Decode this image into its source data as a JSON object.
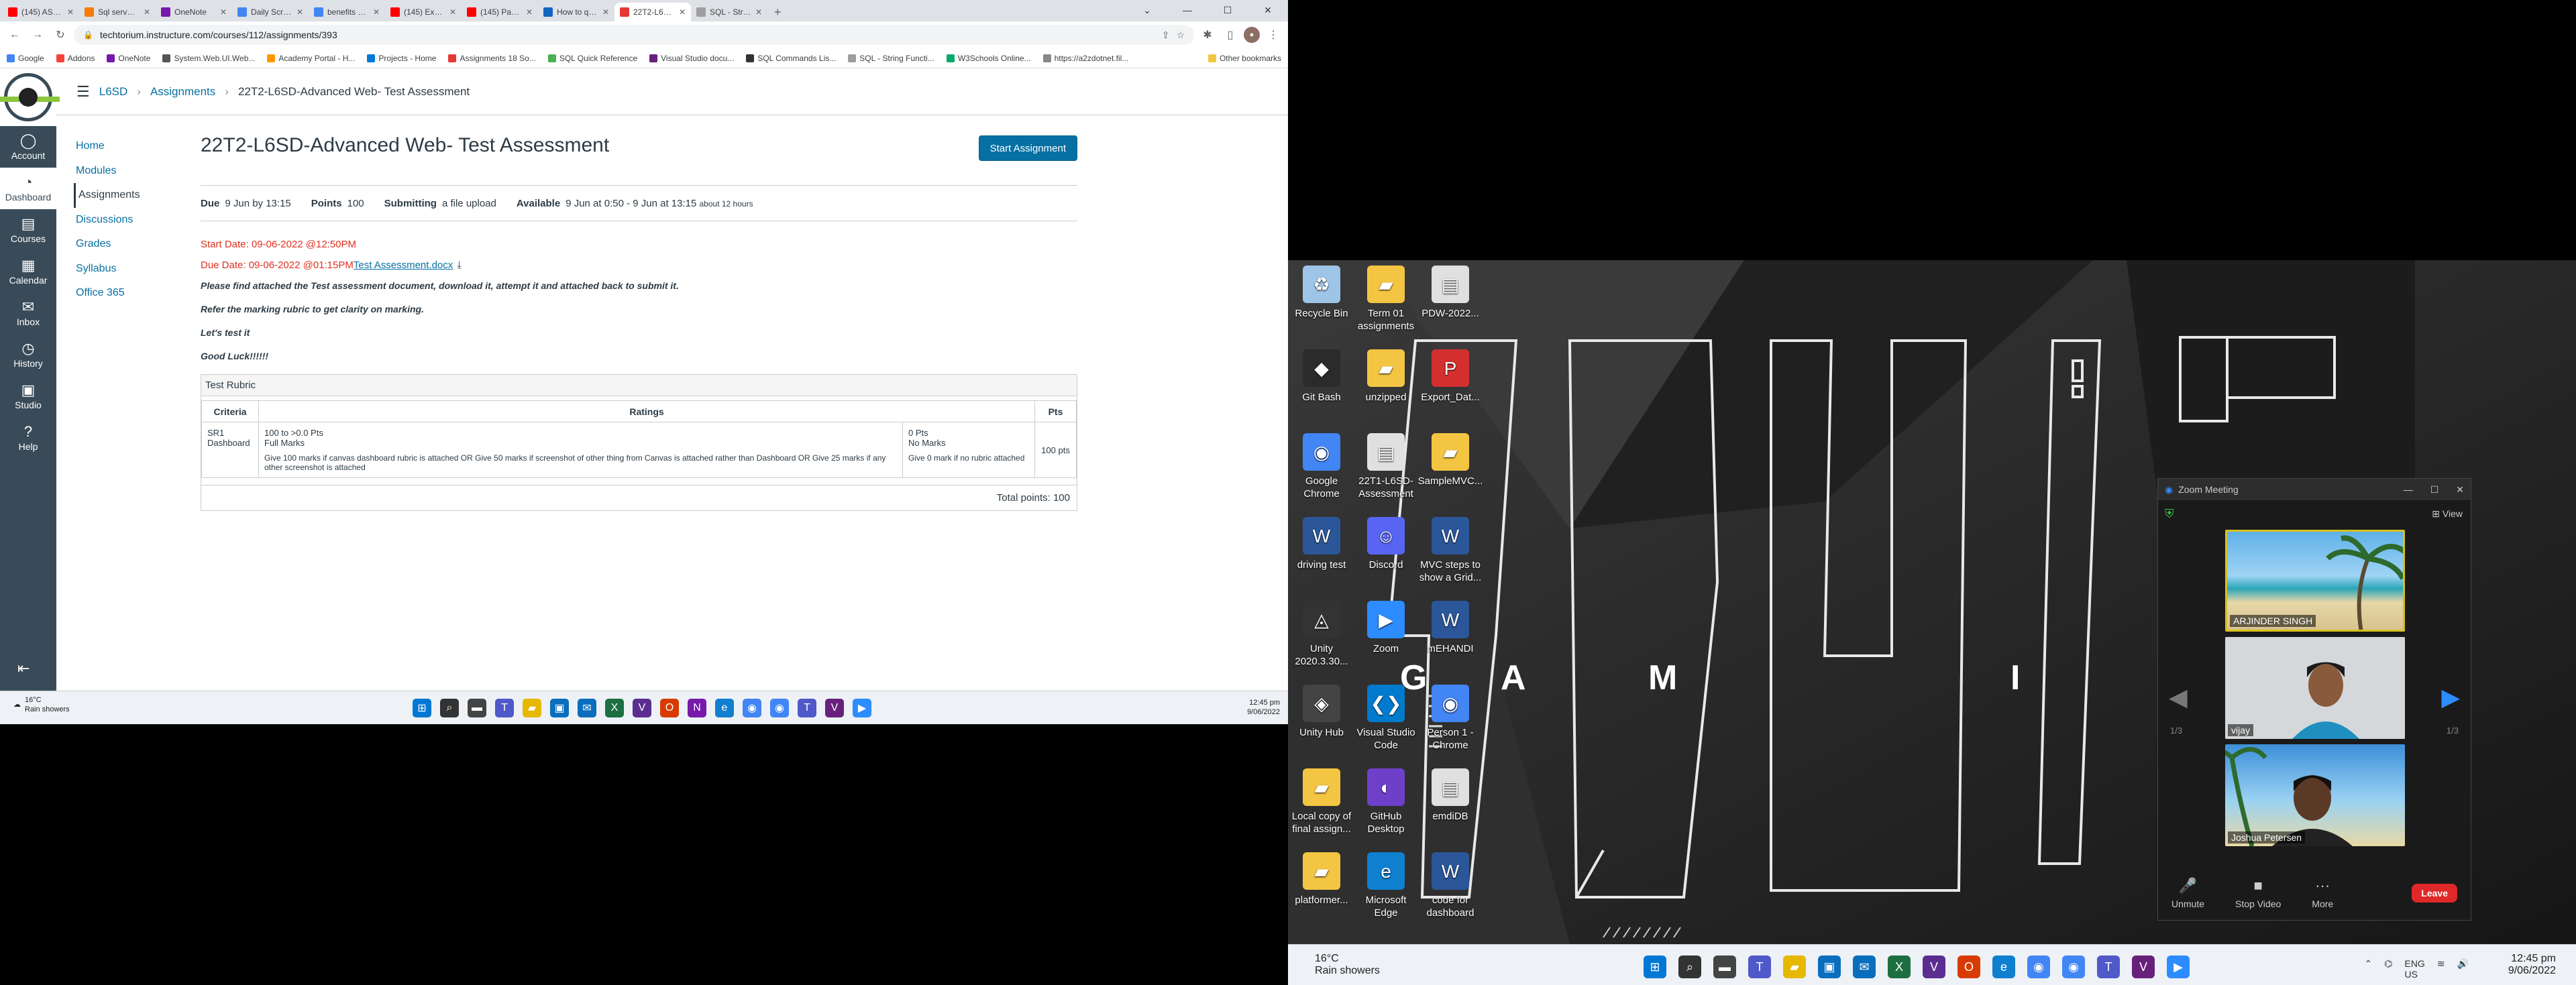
{
  "browser": {
    "tabs": [
      {
        "label": "(145) ASP.NET Co...",
        "color": "#ff0000"
      },
      {
        "label": "Sql server...net an...",
        "color": "#f57c00"
      },
      {
        "label": "OneNote",
        "color": "#7719aa"
      },
      {
        "label": "Daily Scrum Meeti...",
        "color": "#4285f4"
      },
      {
        "label": "benefits of reposit...",
        "color": "#4285f4"
      },
      {
        "label": "(145) Execute Auto...",
        "color": "#ff0000"
      },
      {
        "label": "(145) Part 2 - Crea...",
        "color": "#ff0000"
      },
      {
        "label": "How to query mul...",
        "color": "#1565c0"
      },
      {
        "label": "22T2-L6SD-Advan...",
        "color": "#e53935"
      },
      {
        "label": "SQL - String Functi...",
        "color": "#9e9e9e"
      }
    ],
    "url": "techtorium.instructure.com/courses/112/assignments/393",
    "bookmarks": [
      {
        "label": "Google",
        "color": "#4285f4"
      },
      {
        "label": "Addons",
        "color": "#f44336"
      },
      {
        "label": "OneNote",
        "color": "#7719aa"
      },
      {
        "label": "System.Web.UI.Web...",
        "color": "#555555"
      },
      {
        "label": "Academy Portal - H...",
        "color": "#ff9800"
      },
      {
        "label": "Projects - Home",
        "color": "#0078d4"
      },
      {
        "label": "Assignments 18 So...",
        "color": "#e53935"
      },
      {
        "label": "SQL Quick Reference",
        "color": "#4caf50"
      },
      {
        "label": "Visual Studio docu...",
        "color": "#68217a"
      },
      {
        "label": "SQL Commands Lis...",
        "color": "#333333"
      },
      {
        "label": "SQL - String Functi...",
        "color": "#9e9e9e"
      },
      {
        "label": "W3Schools Online...",
        "color": "#04aa6d"
      },
      {
        "label": "https://a2zdotnet.fil...",
        "color": "#888888"
      }
    ],
    "other_bookmarks": "Other bookmarks"
  },
  "global_nav": [
    {
      "label": "Account",
      "icon": "account-icon"
    },
    {
      "label": "Dashboard",
      "icon": "dashboard-icon"
    },
    {
      "label": "Courses",
      "icon": "courses-icon"
    },
    {
      "label": "Calendar",
      "icon": "calendar-icon"
    },
    {
      "label": "Inbox",
      "icon": "inbox-icon"
    },
    {
      "label": "History",
      "icon": "history-icon"
    },
    {
      "label": "Studio",
      "icon": "studio-icon"
    },
    {
      "label": "Help",
      "icon": "help-icon"
    }
  ],
  "breadcrumb": {
    "course": "L6SD",
    "section": "Assignments",
    "page": "22T2-L6SD-Advanced Web- Test Assessment"
  },
  "course_nav": [
    "Home",
    "Modules",
    "Assignments",
    "Discussions",
    "Grades",
    "Syllabus",
    "Office 365"
  ],
  "assignment": {
    "title": "22T2-L6SD-Advanced Web- Test Assessment",
    "start_button": "Start Assignment",
    "due_label": "Due",
    "due_value": "9 Jun by 13:15",
    "points_label": "Points",
    "points_value": "100",
    "submitting_label": "Submitting",
    "submitting_value": "a file upload",
    "available_label": "Available",
    "available_value": "9 Jun at 0:50 - 9 Jun at 13:15",
    "available_note": "about 12 hours",
    "start_date": "Start Date: 09-06-2022 @12:50PM",
    "due_date": "Due Date: 09-06-2022 @01:15PM",
    "attachment": "Test Assessment.docx",
    "instructions": [
      "Please find attached the Test assessment document, download it, attempt it and attached back to submit it.",
      "Refer the marking rubric to get clarity on marking.",
      "Let's test it",
      "Good Luck!!!!!!"
    ]
  },
  "rubric": {
    "title": "Test Rubric",
    "col_criteria": "Criteria",
    "col_ratings": "Ratings",
    "col_pts": "Pts",
    "criterion_code": "SR1",
    "criterion_name": "Dashboard",
    "rating1_range": "100 to >0.0 Pts",
    "rating1_title": "Full Marks",
    "rating1_desc": "Give 100 marks if canvas dashboard rubric is attached OR Give 50 marks if screenshot of other thing from Canvas is attached rather than Dashboard OR Give 25 marks if any other screenshot is attached",
    "rating2_range": "0 Pts",
    "rating2_title": "No Marks",
    "rating2_desc": "Give 0 mark if no rubric attached",
    "pts": "100 pts",
    "total": "Total points: 100"
  },
  "taskbar_left": {
    "temp": "16°C",
    "weather": "Rain showers",
    "time": "12:45 pm",
    "date": "9/06/2022"
  },
  "desktop_icons": [
    {
      "label": "Recycle Bin",
      "col": 0,
      "row": 0,
      "color": "#9ec5e8",
      "icon": "recycle-bin-icon"
    },
    {
      "label": "Term 01 assignments",
      "col": 1,
      "row": 0,
      "color": "#f4c542",
      "icon": "folder-icon"
    },
    {
      "label": "PDW-2022...",
      "col": 2,
      "row": 0,
      "color": "#e0e0e0",
      "icon": "document-icon"
    },
    {
      "label": "Git Bash",
      "col": 0,
      "row": 1,
      "color": "#2b2b2b",
      "icon": "git-bash-icon"
    },
    {
      "label": "unzipped",
      "col": 1,
      "row": 1,
      "color": "#f4c542",
      "icon": "folder-icon"
    },
    {
      "label": "Export_Dat...",
      "col": 2,
      "row": 1,
      "color": "#d32f2f",
      "icon": "pdf-icon"
    },
    {
      "label": "Google Chrome",
      "col": 0,
      "row": 2,
      "color": "#4285f4",
      "icon": "chrome-icon"
    },
    {
      "label": "22T1-L6SD-Assessment",
      "col": 1,
      "row": 2,
      "color": "#e0e0e0",
      "icon": "document-icon"
    },
    {
      "label": "SampleMVC...",
      "col": 2,
      "row": 2,
      "color": "#f4c542",
      "icon": "folder-icon"
    },
    {
      "label": "driving test",
      "col": 0,
      "row": 3,
      "color": "#2b579a",
      "icon": "word-icon"
    },
    {
      "label": "Discord",
      "col": 1,
      "row": 3,
      "color": "#5865f2",
      "icon": "discord-icon"
    },
    {
      "label": "MVC steps to show a Grid...",
      "col": 2,
      "row": 3,
      "color": "#2b579a",
      "icon": "word-icon"
    },
    {
      "label": "Unity 2020.3.30...",
      "col": 0,
      "row": 4,
      "color": "#333333",
      "icon": "unity-icon"
    },
    {
      "label": "Zoom",
      "col": 1,
      "row": 4,
      "color": "#2d8cff",
      "icon": "zoom-icon"
    },
    {
      "label": "mEHANDI",
      "col": 2,
      "row": 4,
      "color": "#2b579a",
      "icon": "word-icon"
    },
    {
      "label": "Unity Hub",
      "col": 0,
      "row": 5,
      "color": "#444444",
      "icon": "unity-hub-icon"
    },
    {
      "label": "Visual Studio Code",
      "col": 1,
      "row": 5,
      "color": "#007acc",
      "icon": "vscode-icon"
    },
    {
      "label": "Person 1 - Chrome",
      "col": 2,
      "row": 5,
      "color": "#4285f4",
      "icon": "chrome-icon"
    },
    {
      "label": "Local copy of final assign...",
      "col": 0,
      "row": 6,
      "color": "#f4c542",
      "icon": "folder-icon"
    },
    {
      "label": "GitHub Desktop",
      "col": 1,
      "row": 6,
      "color": "#6e40c9",
      "icon": "github-icon"
    },
    {
      "label": "emdiDB",
      "col": 2,
      "row": 6,
      "color": "#e0e0e0",
      "icon": "document-icon"
    },
    {
      "label": "platformer...",
      "col": 0,
      "row": 7,
      "color": "#f4c542",
      "icon": "folder-icon"
    },
    {
      "label": "Microsoft Edge",
      "col": 1,
      "row": 7,
      "color": "#0f7fd0",
      "icon": "edge-icon"
    },
    {
      "label": "code for dashboard",
      "col": 2,
      "row": 7,
      "color": "#2b579a",
      "icon": "word-icon"
    }
  ],
  "wallpaper_letters": [
    "G",
    "A",
    "M",
    "I"
  ],
  "zoom": {
    "title": "Zoom Meeting",
    "view": "View",
    "participants": [
      "ARJINDER SINGH",
      "vijay",
      "Joshua Petersen"
    ],
    "page_indicator": "1/3",
    "unmute": "Unmute",
    "stop_video": "Stop Video",
    "more": "More",
    "leave": "Leave"
  },
  "taskbar_right": {
    "temp": "16°C",
    "weather": "Rain showers",
    "lang": "ENG",
    "region": "US",
    "time": "12:45 pm",
    "date": "9/06/2022"
  }
}
